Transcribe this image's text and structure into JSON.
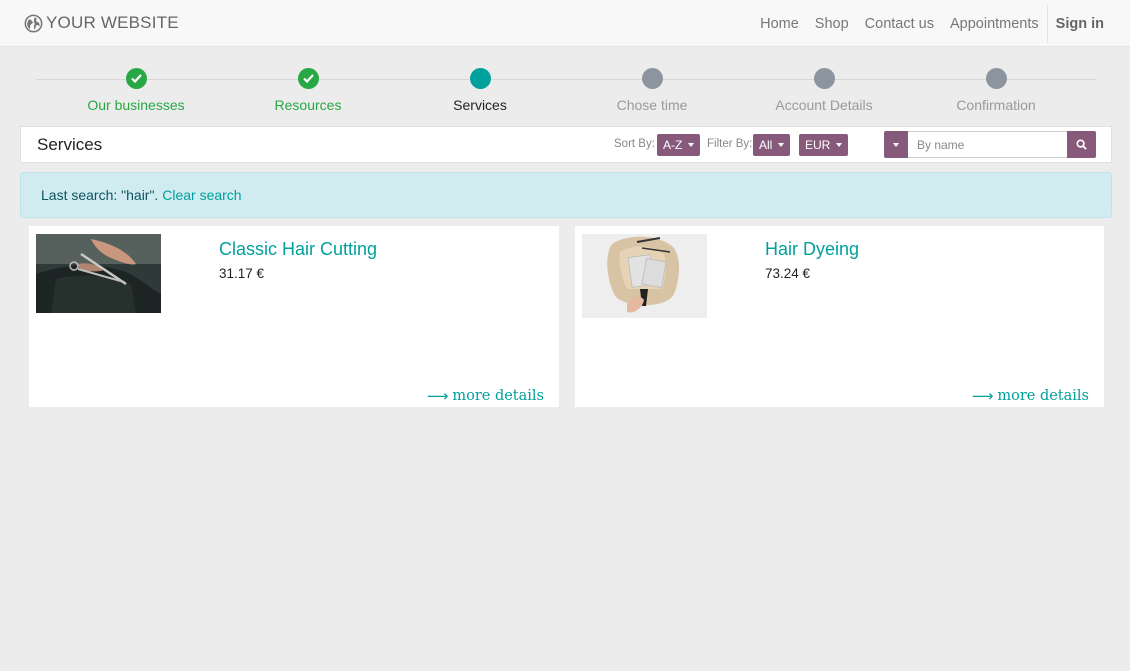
{
  "header": {
    "logo_text": "YOUR WEBSITE",
    "nav": [
      {
        "label": "Home"
      },
      {
        "label": "Shop"
      },
      {
        "label": "Contact us"
      },
      {
        "label": "Appointments"
      }
    ],
    "sign_in": "Sign in"
  },
  "steps": [
    {
      "label": "Our businesses",
      "state": "done"
    },
    {
      "label": "Resources",
      "state": "done"
    },
    {
      "label": "Services",
      "state": "active"
    },
    {
      "label": "Chose time",
      "state": "todo"
    },
    {
      "label": "Account Details",
      "state": "todo"
    },
    {
      "label": "Confirmation",
      "state": "todo"
    }
  ],
  "toolbar": {
    "title": "Services",
    "sort_label": "Sort By:",
    "sort_value": "A-Z",
    "filter_label": "Filter By:",
    "filter_value": "All",
    "currency_value": "EUR",
    "search_placeholder": "By name"
  },
  "alert": {
    "text": "Last search: \"hair\".",
    "clear_link": "Clear search"
  },
  "services": [
    {
      "name": "Classic Hair Cutting",
      "price": "31.17 €",
      "more": "more details"
    },
    {
      "name": "Hair Dyeing",
      "price": "73.24 €",
      "more": "more details"
    }
  ],
  "colors": {
    "primary": "#875a7b",
    "accent": "#00a09d",
    "success": "#28a745",
    "pending": "#8c959f"
  }
}
